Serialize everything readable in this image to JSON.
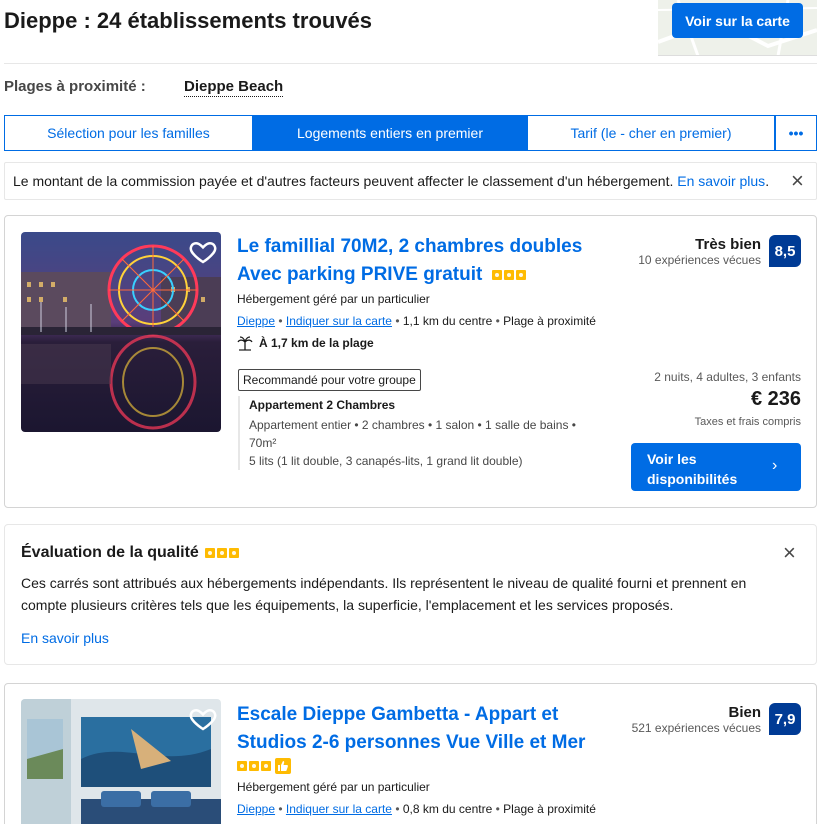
{
  "header": {
    "title": "Dieppe : 24 établissements trouvés",
    "map_button": "Voir sur la carte"
  },
  "beaches": {
    "label": "Plages à proximité :",
    "item": "Dieppe Beach"
  },
  "sort_tabs": [
    {
      "label": "Sélection pour les familles",
      "active": false
    },
    {
      "label": "Logements entiers en premier",
      "active": true
    },
    {
      "label": "Tarif (le - cher en premier)",
      "active": false
    },
    {
      "label": "•••",
      "active": false
    }
  ],
  "notice": {
    "text": "Le montant de la commission payée et d'autres facteurs peuvent affecter le classement d'un hébergement.",
    "link": "En savoir plus",
    "after_link": "."
  },
  "listing1": {
    "title_line1": "Le famillial 70M2, 2 chambres doubles",
    "title_line2": "Avec parking PRIVE gratuit",
    "host": "Hébergement géré par un particulier",
    "city": "Dieppe",
    "map_link": "Indiquer sur la carte",
    "distance": "1,1 km du centre",
    "beach": "Plage à proximité",
    "beach_distance": "À 1,7 km de la plage",
    "score_label": "Très bien",
    "reviews": "10 expériences vécues",
    "score": "8,5",
    "recommended": "Recommandé pour votre groupe",
    "unit_name": "Appartement 2 Chambres",
    "unit_desc": "Appartement entier • 2 chambres • 1 salon • 1 salle de bains •",
    "unit_size": "70m²",
    "beds": "5 lits (1 lit double, 3 canapés-lits, 1 grand lit double)",
    "stay": "2 nuits, 4 adultes, 3 enfants",
    "price": "€ 236",
    "taxes": "Taxes et frais compris",
    "cta_line1": "Voir les",
    "cta_line2": "disponibilités",
    "stars": 3
  },
  "quality": {
    "title": "Évaluation de la qualité",
    "text": "Ces carrés sont attribués aux hébergements indépendants. Ils représentent le niveau de qualité fourni et prennent en compte plusieurs critères tels que les équipements, la superficie, l'emplacement et les services proposés.",
    "link": "En savoir plus",
    "stars": 3
  },
  "listing2": {
    "title_line1": "Escale Dieppe Gambetta - Appart et",
    "title_line2": "Studios 2-6 personnes Vue Ville et Mer",
    "host": "Hébergement géré par un particulier",
    "city": "Dieppe",
    "map_link": "Indiquer sur la carte",
    "distance": "0,8 km du centre",
    "beach": "Plage à proximité",
    "score_label": "Bien",
    "reviews": "521 expériences vécues",
    "score": "7,9",
    "stars": 3
  },
  "icons": [
    "heart-icon",
    "palm-tree-icon",
    "chevron-right-icon",
    "close-icon",
    "thumbs-up-icon"
  ],
  "colors": {
    "brand_blue": "#006ce4",
    "score_navy": "#003b95",
    "star_yellow": "#febb02"
  }
}
